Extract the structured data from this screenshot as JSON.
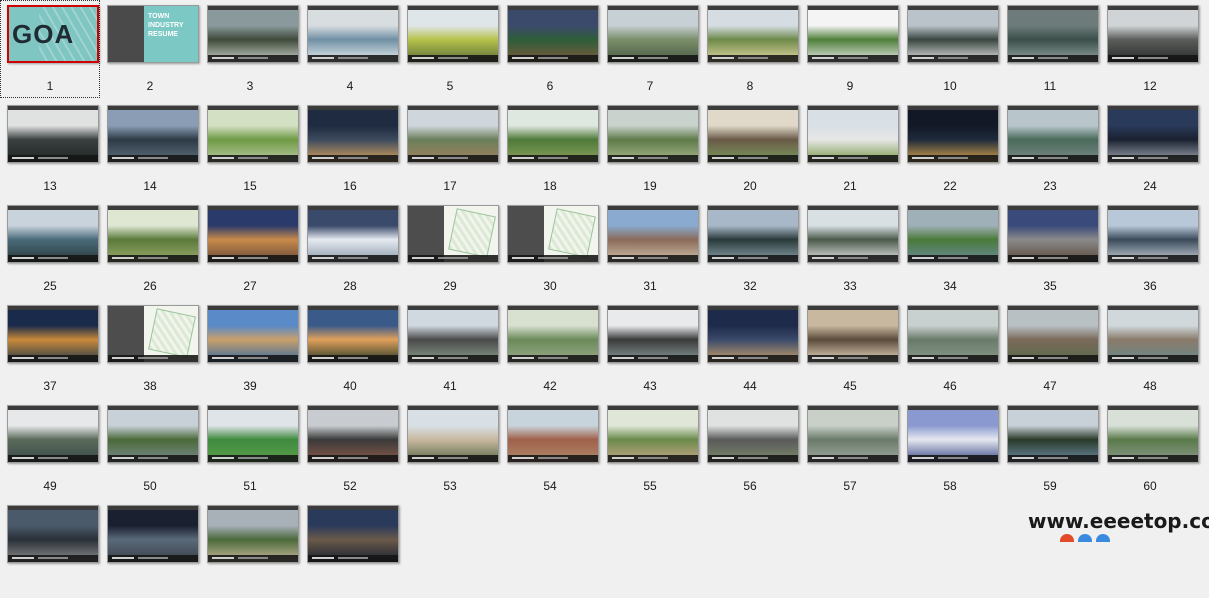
{
  "selected_index": 0,
  "cover": {
    "logo_text": "GOA"
  },
  "resume": {
    "title_lines": [
      "TOWN",
      "INDUSTRY",
      "RESUME"
    ]
  },
  "slides": [
    {
      "label": "1",
      "kind": "cover"
    },
    {
      "label": "2",
      "kind": "resume"
    },
    {
      "label": "3",
      "kind": "photo",
      "colors": [
        "#8a9a9c",
        "#3f4a3a",
        "#c9cfc7"
      ]
    },
    {
      "label": "4",
      "kind": "photo",
      "colors": [
        "#d8dde0",
        "#6f8fa4",
        "#e8eef0"
      ]
    },
    {
      "label": "5",
      "kind": "photo",
      "colors": [
        "#dfe6ea",
        "#b7c24a",
        "#5b6e3b"
      ]
    },
    {
      "label": "6",
      "kind": "photo",
      "colors": [
        "#3b4a6a",
        "#2f5d3a",
        "#7a5a3a"
      ]
    },
    {
      "label": "7",
      "kind": "photo",
      "colors": [
        "#c7d0d4",
        "#7a8e6a",
        "#4a5a44"
      ]
    },
    {
      "label": "8",
      "kind": "photo",
      "colors": [
        "#d5dde3",
        "#6d8a4a",
        "#e4d7a0"
      ]
    },
    {
      "label": "9",
      "kind": "photo",
      "colors": [
        "#f4f4f4",
        "#4f7f3a",
        "#e8e8e8"
      ]
    },
    {
      "label": "10",
      "kind": "photo",
      "colors": [
        "#b9c3c9",
        "#3a4640",
        "#e6e6e6"
      ]
    },
    {
      "label": "11",
      "kind": "photo",
      "colors": [
        "#6d7c7a",
        "#3a4e4a",
        "#93a39f"
      ]
    },
    {
      "label": "12",
      "kind": "photo",
      "colors": [
        "#d0d4d6",
        "#5b5d5b",
        "#2a2c2b"
      ]
    },
    {
      "label": "13",
      "kind": "photo",
      "colors": [
        "#e0e2e2",
        "#3a4040",
        "#1e2624"
      ]
    },
    {
      "label": "14",
      "kind": "photo",
      "colors": [
        "#8a9db4",
        "#2d3b46",
        "#5c6e7c"
      ]
    },
    {
      "label": "15",
      "kind": "photo",
      "colors": [
        "#d3e0c3",
        "#6f9a45",
        "#b8cba0"
      ]
    },
    {
      "label": "16",
      "kind": "photo",
      "colors": [
        "#1f2b40",
        "#3c4a5e",
        "#d7a25a"
      ]
    },
    {
      "label": "17",
      "kind": "photo",
      "colors": [
        "#cfd7dc",
        "#6b7f5a",
        "#a28060"
      ]
    },
    {
      "label": "18",
      "kind": "photo",
      "colors": [
        "#dfe8e0",
        "#4f7a3a",
        "#8aa05a"
      ]
    },
    {
      "label": "19",
      "kind": "photo",
      "colors": [
        "#c9d2cc",
        "#5f7a4a",
        "#a8b88a"
      ]
    },
    {
      "label": "20",
      "kind": "photo",
      "colors": [
        "#e0d8c8",
        "#6a5a48",
        "#7a9a5a"
      ]
    },
    {
      "label": "21",
      "kind": "photo",
      "colors": [
        "#d8e0e6",
        "#e6e6e6",
        "#7a9a4a"
      ]
    },
    {
      "label": "22",
      "kind": "photo",
      "colors": [
        "#121826",
        "#1e2a3a",
        "#d9a34a"
      ]
    },
    {
      "label": "23",
      "kind": "photo",
      "colors": [
        "#b8c6cc",
        "#4a6a5a",
        "#7a8a8a"
      ]
    },
    {
      "label": "24",
      "kind": "photo",
      "colors": [
        "#2a3a5a",
        "#1a2030",
        "#a0a8b0"
      ]
    },
    {
      "label": "25",
      "kind": "photo",
      "colors": [
        "#c8d3dc",
        "#4a6a7a",
        "#2a3a3a"
      ]
    },
    {
      "label": "26",
      "kind": "photo",
      "colors": [
        "#dfe6d2",
        "#5a7a3a",
        "#9aaa6a"
      ]
    },
    {
      "label": "27",
      "kind": "photo",
      "colors": [
        "#2a3a6a",
        "#c88a4a",
        "#6a4a3a"
      ]
    },
    {
      "label": "28",
      "kind": "photo",
      "colors": [
        "#3a4a6a",
        "#e6eaf0",
        "#8a9aaa"
      ]
    },
    {
      "label": "29",
      "kind": "plan"
    },
    {
      "label": "30",
      "kind": "plan"
    },
    {
      "label": "31",
      "kind": "photo",
      "colors": [
        "#8aaad0",
        "#8a6a5a",
        "#cfc0a8"
      ]
    },
    {
      "label": "32",
      "kind": "photo",
      "colors": [
        "#a8b8c8",
        "#2a3a3a",
        "#8aa0a8"
      ]
    },
    {
      "label": "33",
      "kind": "photo",
      "colors": [
        "#d8e0e4",
        "#4a5a4a",
        "#e8e8e8"
      ]
    },
    {
      "label": "34",
      "kind": "photo",
      "colors": [
        "#a0b0b8",
        "#4a7a3a",
        "#6a8a9a"
      ]
    },
    {
      "label": "35",
      "kind": "photo",
      "colors": [
        "#3a4a7a",
        "#8a8a8a",
        "#5a4a3a"
      ]
    },
    {
      "label": "36",
      "kind": "photo",
      "colors": [
        "#b8c8d8",
        "#3a4a5a",
        "#c8d0d8"
      ]
    },
    {
      "label": "37",
      "kind": "photo",
      "colors": [
        "#1a2a4a",
        "#c88a3a",
        "#2a3a4a"
      ]
    },
    {
      "label": "38",
      "kind": "plan"
    },
    {
      "label": "39",
      "kind": "photo",
      "colors": [
        "#5a8ac8",
        "#c8a06a",
        "#3a6aa0"
      ]
    },
    {
      "label": "40",
      "kind": "photo",
      "colors": [
        "#3a5a8a",
        "#e0a05a",
        "#2a3a2a"
      ]
    },
    {
      "label": "41",
      "kind": "photo",
      "colors": [
        "#d0d8e0",
        "#4a4a4a",
        "#8a9a8a"
      ]
    },
    {
      "label": "42",
      "kind": "photo",
      "colors": [
        "#d8e0d0",
        "#6a8a5a",
        "#9aaa8a"
      ]
    },
    {
      "label": "43",
      "kind": "photo",
      "colors": [
        "#e8eaec",
        "#3a3a3a",
        "#8a9a9a"
      ]
    },
    {
      "label": "44",
      "kind": "photo",
      "colors": [
        "#1e2a4a",
        "#3a4a6a",
        "#c8a06a"
      ]
    },
    {
      "label": "45",
      "kind": "photo",
      "colors": [
        "#c8b8a0",
        "#5a4a3a",
        "#e8d8c0"
      ]
    },
    {
      "label": "46",
      "kind": "photo",
      "colors": [
        "#c8d0d0",
        "#6a7a6a",
        "#8a9a8a"
      ]
    },
    {
      "label": "47",
      "kind": "photo",
      "colors": [
        "#b8c0c4",
        "#7a6a5a",
        "#5a6a4a"
      ]
    },
    {
      "label": "48",
      "kind": "photo",
      "colors": [
        "#d0d8dc",
        "#8a7a6a",
        "#6a8a8a"
      ]
    },
    {
      "label": "49",
      "kind": "photo",
      "colors": [
        "#e6e8ea",
        "#5a6a5a",
        "#3a4a4a"
      ]
    },
    {
      "label": "50",
      "kind": "photo",
      "colors": [
        "#c8d0d8",
        "#4a6a3a",
        "#7a8a8a"
      ]
    },
    {
      "label": "51",
      "kind": "photo",
      "colors": [
        "#dfe4e8",
        "#3f8a3f",
        "#5aa04a"
      ]
    },
    {
      "label": "52",
      "kind": "photo",
      "colors": [
        "#c8ccd0",
        "#3a3a3a",
        "#8a5a4a"
      ]
    },
    {
      "label": "53",
      "kind": "photo",
      "colors": [
        "#d8e0e6",
        "#c8b8a0",
        "#5a6a4a"
      ]
    },
    {
      "label": "54",
      "kind": "photo",
      "colors": [
        "#c8d4dc",
        "#a0604a",
        "#b08a6a"
      ]
    },
    {
      "label": "55",
      "kind": "photo",
      "colors": [
        "#e0e6d8",
        "#6a8a4a",
        "#c8a88a"
      ]
    },
    {
      "label": "56",
      "kind": "photo",
      "colors": [
        "#e0e2e2",
        "#5a5a5a",
        "#7a8a6a"
      ]
    },
    {
      "label": "57",
      "kind": "photo",
      "colors": [
        "#c8d0c8",
        "#6a7a6a",
        "#a0aaa0"
      ]
    },
    {
      "label": "58",
      "kind": "photo",
      "colors": [
        "#8a9ad0",
        "#e6e8f0",
        "#3a4a8a"
      ]
    },
    {
      "label": "59",
      "kind": "photo",
      "colors": [
        "#c8d0d8",
        "#2a3a2a",
        "#6a8aa0"
      ]
    },
    {
      "label": "60",
      "kind": "photo",
      "colors": [
        "#d8e0d8",
        "#5a7a4a",
        "#8a9a8a"
      ]
    },
    {
      "label": "",
      "kind": "photo",
      "colors": [
        "#4a5a6a",
        "#2a3038",
        "#8a8a8a"
      ]
    },
    {
      "label": "",
      "kind": "photo",
      "colors": [
        "#1a2030",
        "#5a6a7a",
        "#3a4048"
      ]
    },
    {
      "label": "",
      "kind": "photo",
      "colors": [
        "#a8b0b8",
        "#4a6a3a",
        "#c8b89a"
      ]
    },
    {
      "label": "",
      "kind": "photo",
      "colors": [
        "#2a3a5a",
        "#6a5a4a",
        "#1a2030"
      ]
    }
  ],
  "watermark": {
    "text": "www.eeeetop.com"
  }
}
